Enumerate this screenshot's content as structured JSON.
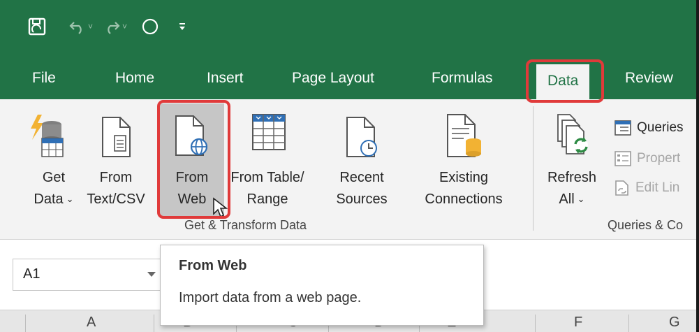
{
  "colors": {
    "accent_green": "#217346",
    "ribbon_bg": "#f3f3f3",
    "highlight_red": "#e03a3a"
  },
  "qat": {
    "icons": [
      "save-icon",
      "undo-icon",
      "redo-icon",
      "touch-mode-icon",
      "customize-qat-icon"
    ]
  },
  "tabs": [
    {
      "label": "File"
    },
    {
      "label": "Home"
    },
    {
      "label": "Insert"
    },
    {
      "label": "Page Layout"
    },
    {
      "label": "Formulas"
    },
    {
      "label": "Data",
      "active": true
    },
    {
      "label": "Review"
    }
  ],
  "ribbon": {
    "get_transform": {
      "group_label": "Get & Transform Data",
      "buttons": [
        {
          "line1": "Get",
          "line2": "Data",
          "caret": "⌄"
        },
        {
          "line1": "From",
          "line2": "Text/CSV"
        },
        {
          "line1": "From",
          "line2": "Web"
        },
        {
          "line1": "From Table/",
          "line2": "Range"
        },
        {
          "line1": "Recent",
          "line2": "Sources"
        },
        {
          "line1": "Existing",
          "line2": "Connections"
        }
      ]
    },
    "queries": {
      "group_label": "Queries & Co",
      "refresh": {
        "line1": "Refresh",
        "line2": "All",
        "caret": "⌄"
      },
      "small": [
        {
          "label": "Queries",
          "disabled": false
        },
        {
          "label": "Propert",
          "disabled": true
        },
        {
          "label": "Edit Lin",
          "disabled": true
        }
      ]
    }
  },
  "formula_bar": {
    "name_box": "A1"
  },
  "columns": [
    "A",
    "B",
    "C",
    "D",
    "E",
    "F",
    "G"
  ],
  "tooltip": {
    "title": "From Web",
    "description": "Import data from a web page."
  }
}
